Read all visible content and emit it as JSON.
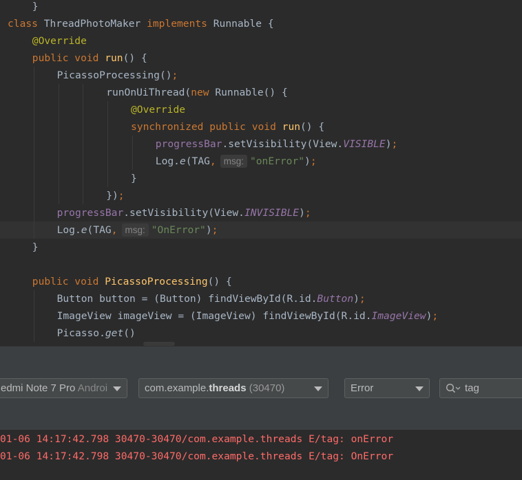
{
  "editor": {
    "lines": [
      {
        "id": "l1",
        "indent": 4,
        "tokens": [
          {
            "t": "}",
            "c": "pl"
          }
        ]
      },
      {
        "id": "l2",
        "indent": 0,
        "tokens": [
          {
            "t": "class ",
            "c": "kw"
          },
          {
            "t": "ThreadPhotoMaker ",
            "c": "pl"
          },
          {
            "t": "implements ",
            "c": "kw"
          },
          {
            "t": "Runnable {",
            "c": "pl"
          }
        ]
      },
      {
        "id": "l3",
        "indent": 4,
        "tokens": [
          {
            "t": "@Override",
            "c": "an"
          }
        ]
      },
      {
        "id": "l4",
        "indent": 4,
        "tokens": [
          {
            "t": "public void ",
            "c": "kw"
          },
          {
            "t": "run",
            "c": "fn"
          },
          {
            "t": "() {",
            "c": "pl"
          }
        ]
      },
      {
        "id": "l5",
        "indent": 8,
        "tokens": [
          {
            "t": "PicassoProcessing()",
            "c": "pl"
          },
          {
            "t": ";",
            "c": "kw"
          }
        ]
      },
      {
        "id": "l6",
        "indent": 16,
        "tokens": [
          {
            "t": "runOnUiThread(",
            "c": "pl"
          },
          {
            "t": "new ",
            "c": "kw"
          },
          {
            "t": "Runnable() {",
            "c": "pl"
          }
        ]
      },
      {
        "id": "l7",
        "indent": 20,
        "tokens": [
          {
            "t": "@Override",
            "c": "an"
          }
        ]
      },
      {
        "id": "l8",
        "indent": 20,
        "tokens": [
          {
            "t": "synchronized public void ",
            "c": "kw"
          },
          {
            "t": "run",
            "c": "fn"
          },
          {
            "t": "() {",
            "c": "pl"
          }
        ]
      },
      {
        "id": "l9",
        "indent": 24,
        "tokens": [
          {
            "t": "progressBar",
            "c": "fld"
          },
          {
            "t": ".setVisibility(View.",
            "c": "pl"
          },
          {
            "t": "VISIBLE",
            "c": "cst"
          },
          {
            "t": ")",
            "c": "pl"
          },
          {
            "t": ";",
            "c": "kw"
          }
        ]
      },
      {
        "id": "l10",
        "indent": 24,
        "tokens": [
          {
            "t": "Log.",
            "c": "pl"
          },
          {
            "t": "e",
            "c": "it"
          },
          {
            "t": "(TAG",
            "c": "pl"
          },
          {
            "t": ",",
            "c": "kw"
          },
          {
            "t": "msg:",
            "c": "hint"
          },
          {
            "t": "\"onError\"",
            "c": "str"
          },
          {
            "t": ")",
            "c": "pl"
          },
          {
            "t": ";",
            "c": "kw"
          }
        ]
      },
      {
        "id": "l11",
        "indent": 20,
        "tokens": [
          {
            "t": "}",
            "c": "pl"
          }
        ]
      },
      {
        "id": "l12",
        "indent": 16,
        "tokens": [
          {
            "t": "})",
            "c": "pl"
          },
          {
            "t": ";",
            "c": "kw"
          }
        ]
      },
      {
        "id": "l13",
        "indent": 8,
        "tokens": [
          {
            "t": "progressBar",
            "c": "fld"
          },
          {
            "t": ".setVisibility(View.",
            "c": "pl"
          },
          {
            "t": "INVISIBLE",
            "c": "cst"
          },
          {
            "t": ")",
            "c": "pl"
          },
          {
            "t": ";",
            "c": "kw"
          }
        ]
      },
      {
        "id": "l14",
        "indent": 8,
        "current": true,
        "tokens": [
          {
            "t": "Log.",
            "c": "pl"
          },
          {
            "t": "e",
            "c": "it"
          },
          {
            "t": "(TAG",
            "c": "pl"
          },
          {
            "t": ",",
            "c": "kw"
          },
          {
            "t": "msg:",
            "c": "hint"
          },
          {
            "t": "\"OnError\"",
            "c": "str"
          },
          {
            "t": ")",
            "c": "pl"
          },
          {
            "t": ";",
            "c": "kw"
          }
        ]
      },
      {
        "id": "l15",
        "indent": 4,
        "tokens": [
          {
            "t": "}",
            "c": "pl"
          }
        ]
      },
      {
        "id": "l16",
        "indent": 0,
        "tokens": []
      },
      {
        "id": "l17",
        "indent": 4,
        "tokens": [
          {
            "t": "public void ",
            "c": "kw"
          },
          {
            "t": "PicassoProcessing",
            "c": "fn"
          },
          {
            "t": "() {",
            "c": "pl"
          }
        ]
      },
      {
        "id": "l18",
        "indent": 8,
        "tokens": [
          {
            "t": "Button button = (Button) findViewById(R.id.",
            "c": "pl"
          },
          {
            "t": "Button",
            "c": "cst"
          },
          {
            "t": ")",
            "c": "pl"
          },
          {
            "t": ";",
            "c": "kw"
          }
        ]
      },
      {
        "id": "l19",
        "indent": 8,
        "tokens": [
          {
            "t": "ImageView imageView = (ImageView) findViewById(R.id.",
            "c": "pl"
          },
          {
            "t": "ImageView",
            "c": "cst"
          },
          {
            "t": ")",
            "c": "pl"
          },
          {
            "t": ";",
            "c": "kw"
          }
        ]
      },
      {
        "id": "l20",
        "indent": 8,
        "tokens": [
          {
            "t": "Picasso.",
            "c": "pl"
          },
          {
            "t": "get",
            "c": "it"
          },
          {
            "t": "()",
            "c": "pl"
          }
        ]
      }
    ]
  },
  "logcat": {
    "device": {
      "name": "edmi Note 7 Pro ",
      "suffix": "Androi"
    },
    "process": {
      "prefix": "com.example.",
      "bold": "threads",
      "pid": " (30470)"
    },
    "level": "Error",
    "search": {
      "value": "tag"
    },
    "lines": [
      "01-06 14:17:42.798 30470-30470/com.example.threads E/tag: onError",
      "01-06 14:17:42.798 30470-30470/com.example.threads E/tag: OnError"
    ]
  },
  "colors": {
    "editor_bg": "#2b2b2b",
    "keyword": "#cc7832",
    "function": "#ffc66d",
    "annotation": "#bbb529",
    "field": "#9876aa",
    "string": "#6a8759",
    "plain": "#a9b7c6",
    "log_error": "#ff6b68",
    "panel_bg": "#3c3f41"
  },
  "icons": {
    "search": "search-icon",
    "dropdown": "chevron-down-icon"
  }
}
